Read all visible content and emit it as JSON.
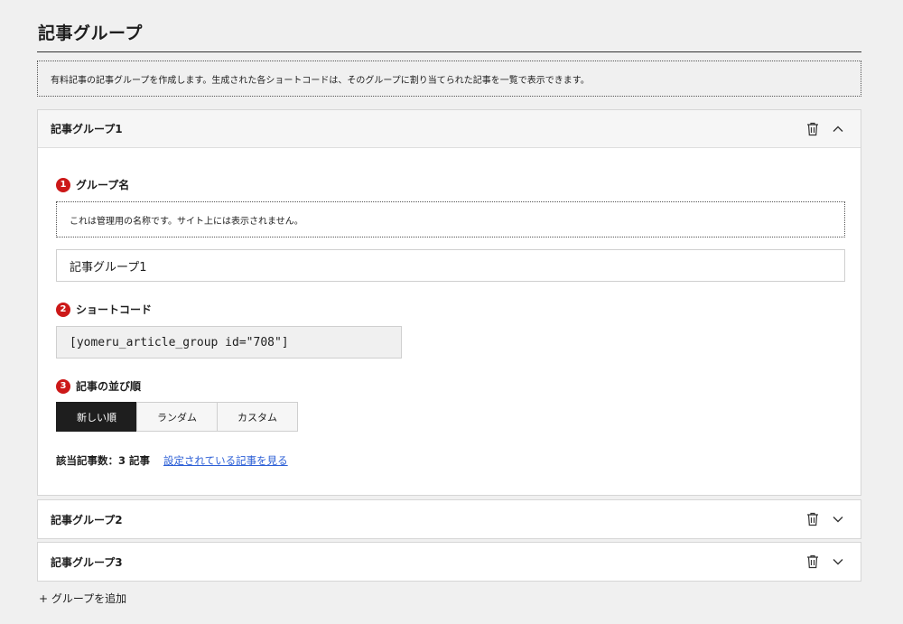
{
  "page": {
    "title": "記事グループ",
    "notice": "有料記事の記事グループを作成します。生成された各ショートコードは、そのグループに割り当てられた記事を一覧で表示できます。"
  },
  "groups": [
    {
      "name": "記事グループ1",
      "expanded": true,
      "steps": [
        {
          "number": "1",
          "label": "グループ名"
        },
        {
          "number": "2",
          "label": "ショートコード"
        },
        {
          "number": "3",
          "label": "記事の並び順"
        }
      ],
      "help_text": "これは管理用の名称です。サイト上には表示されません。",
      "name_input_value": "記事グループ1",
      "shortcode": "[yomeru_article_group id=\"708\"]",
      "order_options": [
        "新しい順",
        "ランダム",
        "カスタム"
      ],
      "selected_order": "新しい順",
      "count_text": "該当記事数：3 記事",
      "view_link": "設定されている記事を見る"
    },
    {
      "name": "記事グループ2",
      "expanded": false
    },
    {
      "name": "記事グループ3",
      "expanded": false
    }
  ],
  "add_group_label": "+ グループを追加",
  "icons": {
    "delete": "trash-icon",
    "collapse": "chevron-up-icon",
    "expand": "chevron-down-icon"
  },
  "colors": {
    "accent_red": "#cc1818",
    "link": "#2c5fd6",
    "active_segment": "#1e1e1e"
  }
}
